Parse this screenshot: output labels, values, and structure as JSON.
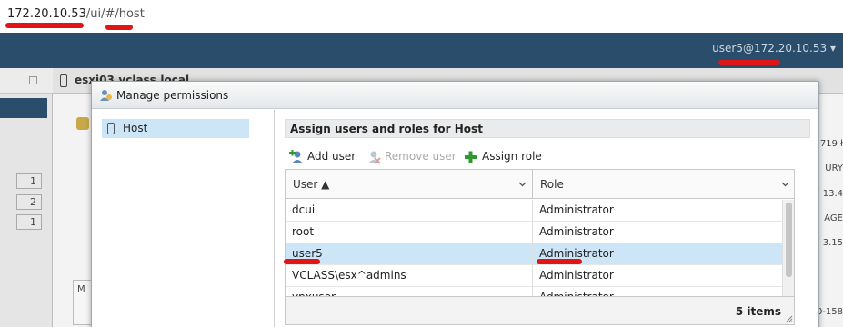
{
  "browser": {
    "url_host": "172.20.10.53",
    "url_path": "/ui/#/host"
  },
  "header": {
    "user_label": "user5@172.20.10.53"
  },
  "background": {
    "tab_title": "esxi03.vclass.local",
    "left_counts": [
      "1",
      "2",
      "1"
    ],
    "box_label": "M",
    "right_fragments": [
      "719 ł",
      "URY",
      "13.4",
      "AGE",
      "3.15",
      "0-158"
    ]
  },
  "dialog": {
    "title": "Manage permissions",
    "tree": {
      "host_label": "Host"
    },
    "section_title": "Assign users and roles for Host",
    "toolbar": {
      "add_user": "Add user",
      "remove_user": "Remove user",
      "assign_role": "Assign role"
    },
    "grid": {
      "columns": {
        "user": "User ▲",
        "role": "Role"
      },
      "rows": [
        {
          "user": "dcui",
          "role": "Administrator"
        },
        {
          "user": "root",
          "role": "Administrator"
        },
        {
          "user": "user5",
          "role": "Administrator",
          "selected": true
        },
        {
          "user": "VCLASS\\esx^admins",
          "role": "Administrator"
        },
        {
          "user": "vpxuser",
          "role": "Administrator"
        }
      ],
      "footer": "5 items"
    }
  },
  "colors": {
    "header_bg": "#2a4d6c",
    "selection": "#cce6f8",
    "annotation_red": "#e01515"
  }
}
